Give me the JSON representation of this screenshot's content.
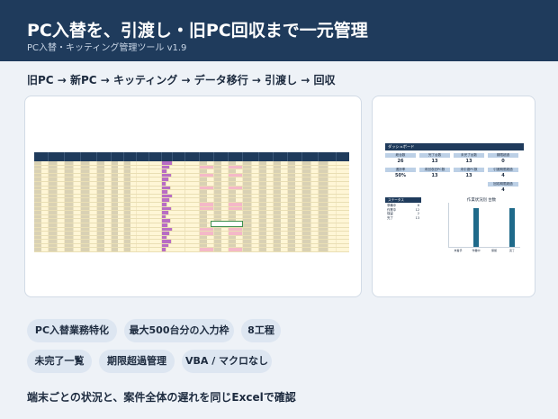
{
  "header": {
    "title": "PC入替を、引渡し・旧PC回収まで一元管理",
    "subtitle": "PC入替・キッティング管理ツール v1.9"
  },
  "flow": "旧PC → 新PC → キッティング → データ移行 → 引渡し → 回収",
  "dashboard": {
    "title": "ダッシュボード",
    "kpi_top": [
      {
        "label": "総台数",
        "value": "26"
      },
      {
        "label": "完了台数",
        "value": "13"
      },
      {
        "label": "未完了台数",
        "value": "13"
      },
      {
        "label": "期限超過",
        "value": "0"
      }
    ],
    "kpi_bottom": [
      {
        "label": "進捗率",
        "value": "50%"
      },
      {
        "label": "未回収旧PC数",
        "value": "13"
      },
      {
        "label": "未引渡PC数",
        "value": "13"
      },
      {
        "label": "引渡期限超過",
        "value": "4"
      }
    ],
    "extra": {
      "label": "回収期限超過",
      "value": "4"
    },
    "status_header": "ステータス",
    "status_rows": [
      {
        "name": "準備中",
        "count": "8"
      },
      {
        "name": "作業中",
        "count": "12"
      },
      {
        "name": "保留",
        "count": "2"
      },
      {
        "name": "完了",
        "count": "13"
      }
    ],
    "chart_title": "作業状況別 台数"
  },
  "chart_data": {
    "type": "bar",
    "title": "作業状況別 台数",
    "categories": [
      "未着手",
      "作業中",
      "保留",
      "完了"
    ],
    "values": [
      0,
      13,
      0,
      13
    ],
    "ylim": [
      0,
      14
    ]
  },
  "chips": [
    "PC入替業務特化",
    "最大500台分の入力枠",
    "8工程",
    "未完了一覧",
    "期限超過管理",
    "VBA / マクロなし"
  ],
  "footer": "端末ごとの状況と、案件全体の遅れを同じExcelで確認"
}
